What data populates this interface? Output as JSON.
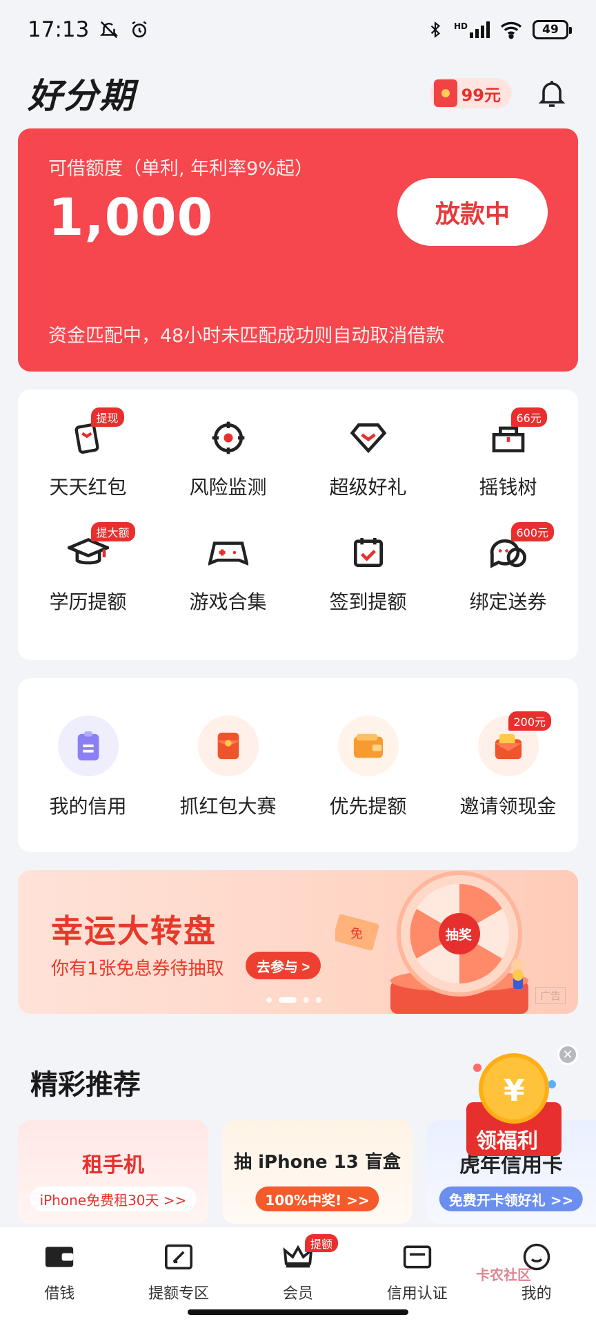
{
  "status_bar": {
    "time": "17:13",
    "battery": "49",
    "network": "HD"
  },
  "header": {
    "logo": "好分期",
    "redpacket_amount": "99元"
  },
  "loan_card": {
    "label": "可借额度（单利, 年利率9%起）",
    "amount": "1,000",
    "status_button": "放款中",
    "notice": "资金匹配中，48小时未匹配成功则自动取消借款"
  },
  "services": [
    {
      "label": "天天红包",
      "badge": "提现",
      "icon": "phone-redpacket-icon"
    },
    {
      "label": "风险监测",
      "badge": "",
      "icon": "target-icon"
    },
    {
      "label": "超级好礼",
      "badge": "",
      "icon": "diamond-icon"
    },
    {
      "label": "摇钱树",
      "badge": "66元",
      "icon": "basket-icon"
    },
    {
      "label": "学历提额",
      "badge": "提大额",
      "icon": "graduation-cap-icon"
    },
    {
      "label": "游戏合集",
      "badge": "",
      "icon": "gamepad-icon"
    },
    {
      "label": "签到提额",
      "badge": "",
      "icon": "calendar-check-icon"
    },
    {
      "label": "绑定送券",
      "badge": "600元",
      "icon": "chat-bubbles-icon"
    }
  ],
  "features": [
    {
      "label": "我的信用",
      "badge": "",
      "icon": "clipboard-icon",
      "bg": "#eeeefd",
      "color": "#7b6ff0"
    },
    {
      "label": "抓红包大赛",
      "badge": "",
      "icon": "redpacket-icon",
      "bg": "#fff0ea",
      "color": "#f0542c"
    },
    {
      "label": "优先提额",
      "badge": "",
      "icon": "wallet-icon",
      "bg": "#fff3ea",
      "color": "#f79a2f"
    },
    {
      "label": "邀请领现金",
      "badge": "200元",
      "icon": "cash-envelope-icon",
      "bg": "#fff1ea",
      "color": "#f0542c"
    }
  ],
  "banner": {
    "title": "幸运大转盘",
    "subtitle": "你有1张免息券待抽取",
    "button": "去参与 >",
    "wheel_label": "抽奖",
    "ticket_label": "免",
    "ad_label": "广告"
  },
  "recommend": {
    "title": "精彩推荐",
    "cards": [
      {
        "title": "租手机",
        "pill": "iPhone免费租30天 >>",
        "title_color": "#e7302e",
        "pill_color": "#e7302e",
        "pill_bg": "#ffffff"
      },
      {
        "title": "抽 iPhone 13 盲盒",
        "pill": "100%中奖! >>",
        "title_color": "#222222",
        "pill_color": "#ffffff",
        "pill_bg": "#f45a2a"
      },
      {
        "title": "虎年信用卡",
        "pill": "免费开卡领好礼 >>",
        "title_color": "#222222",
        "pill_color": "#ffffff",
        "pill_bg": "#6b8ff0"
      }
    ]
  },
  "welfare": {
    "label": "领福利",
    "coin_symbol": "¥"
  },
  "bottom_nav": [
    {
      "label": "借钱",
      "icon": "wallet-nav-icon",
      "badge": ""
    },
    {
      "label": "提额专区",
      "icon": "edit-square-icon",
      "badge": ""
    },
    {
      "label": "会员",
      "icon": "crown-icon",
      "badge": "提额"
    },
    {
      "label": "信用认证",
      "icon": "id-card-icon",
      "badge": ""
    },
    {
      "label": "我的",
      "icon": "smile-icon",
      "badge": ""
    }
  ],
  "watermark": "卡农社区"
}
